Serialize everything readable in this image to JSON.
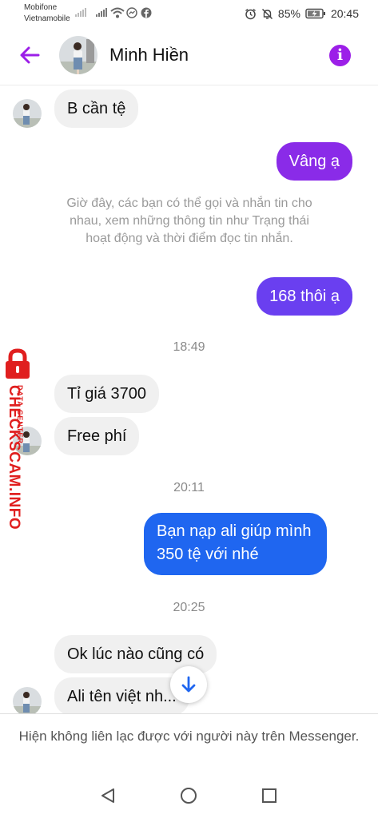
{
  "status_bar": {
    "carrier_1": "Mobifone",
    "carrier_2": "Vietnamobile",
    "battery": "85%",
    "time": "20:45"
  },
  "header": {
    "contact_name": "Minh Hiền",
    "info_glyph": "i"
  },
  "messages": {
    "m1": "B cần tệ",
    "m2": "Vâng ạ",
    "system_note": "Giờ đây, các bạn có thể gọi và nhắn tin cho nhau, xem những thông tin như Trạng thái hoạt động và thời điểm đọc tin nhắn.",
    "m3": "168 thôi ạ",
    "time_1": "18:49",
    "m4": "Tỉ giá 3700",
    "m5": "Free phí",
    "time_2": "20:11",
    "m6_line1": "Bạn nạp ali giúp mình",
    "m6_line2": "350 tệ với nhé",
    "time_3": "20:25",
    "m7": "Ok lúc nào cũng có",
    "m8": "Ali tên việt nh..."
  },
  "watermark": {
    "line1": "DATA CENTER",
    "line2": "CHECKSCAM.INFO"
  },
  "notice": "Hiện không liên lạc được với người này trên Messenger.",
  "colors": {
    "accent": "#9c1fe8",
    "outgoing_purple": "#8a2be8",
    "outgoing_blue": "#1f66f0",
    "incoming": "#f0f0f0",
    "watermark_red": "#e01f1f"
  },
  "icons": [
    "back-arrow-icon",
    "info-icon",
    "alarm-icon",
    "mute-bell-icon",
    "battery-icon",
    "messenger-icon",
    "facebook-icon",
    "wifi-icon",
    "arrow-down-icon",
    "nav-back-icon",
    "nav-home-icon",
    "nav-recents-icon",
    "lock-icon"
  ]
}
